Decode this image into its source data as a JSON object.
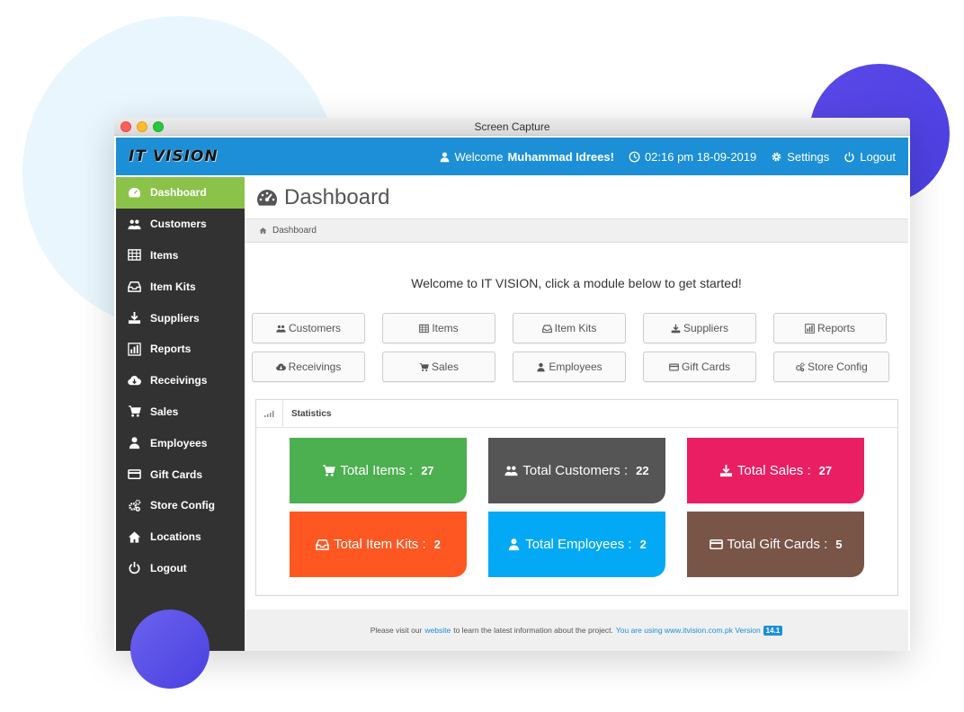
{
  "window": {
    "title": "Screen Capture"
  },
  "header": {
    "logo": "IT VISION",
    "welcome_prefix": "Welcome",
    "user_name": "Muhammad Idrees!",
    "datetime": "02:16 pm 18-09-2019",
    "settings_label": "Settings",
    "logout_label": "Logout"
  },
  "sidebar": {
    "items": [
      {
        "label": "Dashboard",
        "icon": "dashboard-icon"
      },
      {
        "label": "Customers",
        "icon": "users-icon"
      },
      {
        "label": "Items",
        "icon": "table-icon"
      },
      {
        "label": "Item Kits",
        "icon": "inbox-icon"
      },
      {
        "label": "Suppliers",
        "icon": "download-icon"
      },
      {
        "label": "Reports",
        "icon": "bar-chart-icon"
      },
      {
        "label": "Receivings",
        "icon": "cloud-download-icon"
      },
      {
        "label": "Sales",
        "icon": "cart-icon"
      },
      {
        "label": "Employees",
        "icon": "user-icon"
      },
      {
        "label": "Gift Cards",
        "icon": "credit-card-icon"
      },
      {
        "label": "Store Config",
        "icon": "cogs-icon"
      },
      {
        "label": "Locations",
        "icon": "home-icon"
      },
      {
        "label": "Logout",
        "icon": "power-icon"
      }
    ],
    "active_index": 0
  },
  "main": {
    "page_title": "Dashboard",
    "breadcrumb": "Dashboard",
    "welcome_message": "Welcome to IT VISION, click a module below to get started!",
    "modules": [
      {
        "label": "Customers",
        "icon": "users-icon"
      },
      {
        "label": "Items",
        "icon": "table-icon"
      },
      {
        "label": "Item Kits",
        "icon": "inbox-icon"
      },
      {
        "label": "Suppliers",
        "icon": "download-icon"
      },
      {
        "label": "Reports",
        "icon": "bar-chart-icon"
      },
      {
        "label": "Receivings",
        "icon": "cloud-download-icon"
      },
      {
        "label": "Sales",
        "icon": "cart-icon"
      },
      {
        "label": "Employees",
        "icon": "user-icon"
      },
      {
        "label": "Gift Cards",
        "icon": "credit-card-icon"
      },
      {
        "label": "Store Config",
        "icon": "cogs-icon"
      }
    ],
    "statistics": {
      "title": "Statistics",
      "tiles": [
        {
          "label": "Total Items :",
          "value": "27",
          "icon": "cart-icon",
          "color": "#4caf50"
        },
        {
          "label": "Total Customers :",
          "value": "22",
          "icon": "users-icon",
          "color": "#555555"
        },
        {
          "label": "Total Sales :",
          "value": "27",
          "icon": "download-icon",
          "color": "#e91e63"
        },
        {
          "label": "Total Item Kits :",
          "value": "2",
          "icon": "inbox-icon",
          "color": "#ff5722"
        },
        {
          "label": "Total Employees :",
          "value": "2",
          "icon": "user-icon",
          "color": "#03a9f4"
        },
        {
          "label": "Total Gift Cards :",
          "value": "5",
          "icon": "credit-card-icon",
          "color": "#795548"
        }
      ]
    }
  },
  "footer": {
    "text_before": "Please visit our",
    "link_label": "website",
    "text_middle": "to learn the latest information about the project.",
    "text_using": "You are using www.itvision.com.pk Version",
    "version": "14.1"
  },
  "colors": {
    "topbar": "#1c8fd6",
    "sidebar": "#323232",
    "active": "#8bc34a"
  }
}
